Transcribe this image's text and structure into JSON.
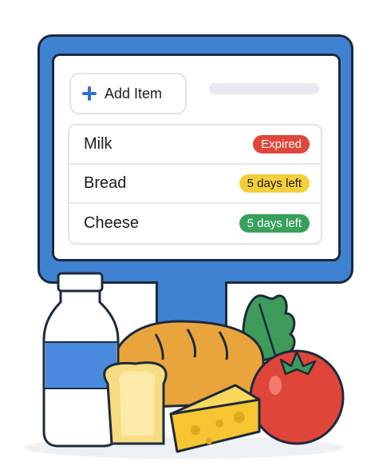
{
  "toolbar": {
    "add_label": "Add Item"
  },
  "items": [
    {
      "name": "Milk",
      "status": "Expired",
      "color": "#e0463a",
      "text_color": "#ffffff"
    },
    {
      "name": "Bread",
      "status": "5 days left",
      "color": "#f4cf3b",
      "text_color": "#1c1c1c"
    },
    {
      "name": "Cheese",
      "status": "5 days left",
      "color": "#36a05c",
      "text_color": "#ffffff"
    }
  ],
  "colors": {
    "monitor": "#3f82d2",
    "outline": "#1c2a3d"
  },
  "illustration": [
    "milk-bottle",
    "bread-loaf",
    "bread-slice",
    "cheese-wedge",
    "tomato",
    "leafy-greens"
  ]
}
